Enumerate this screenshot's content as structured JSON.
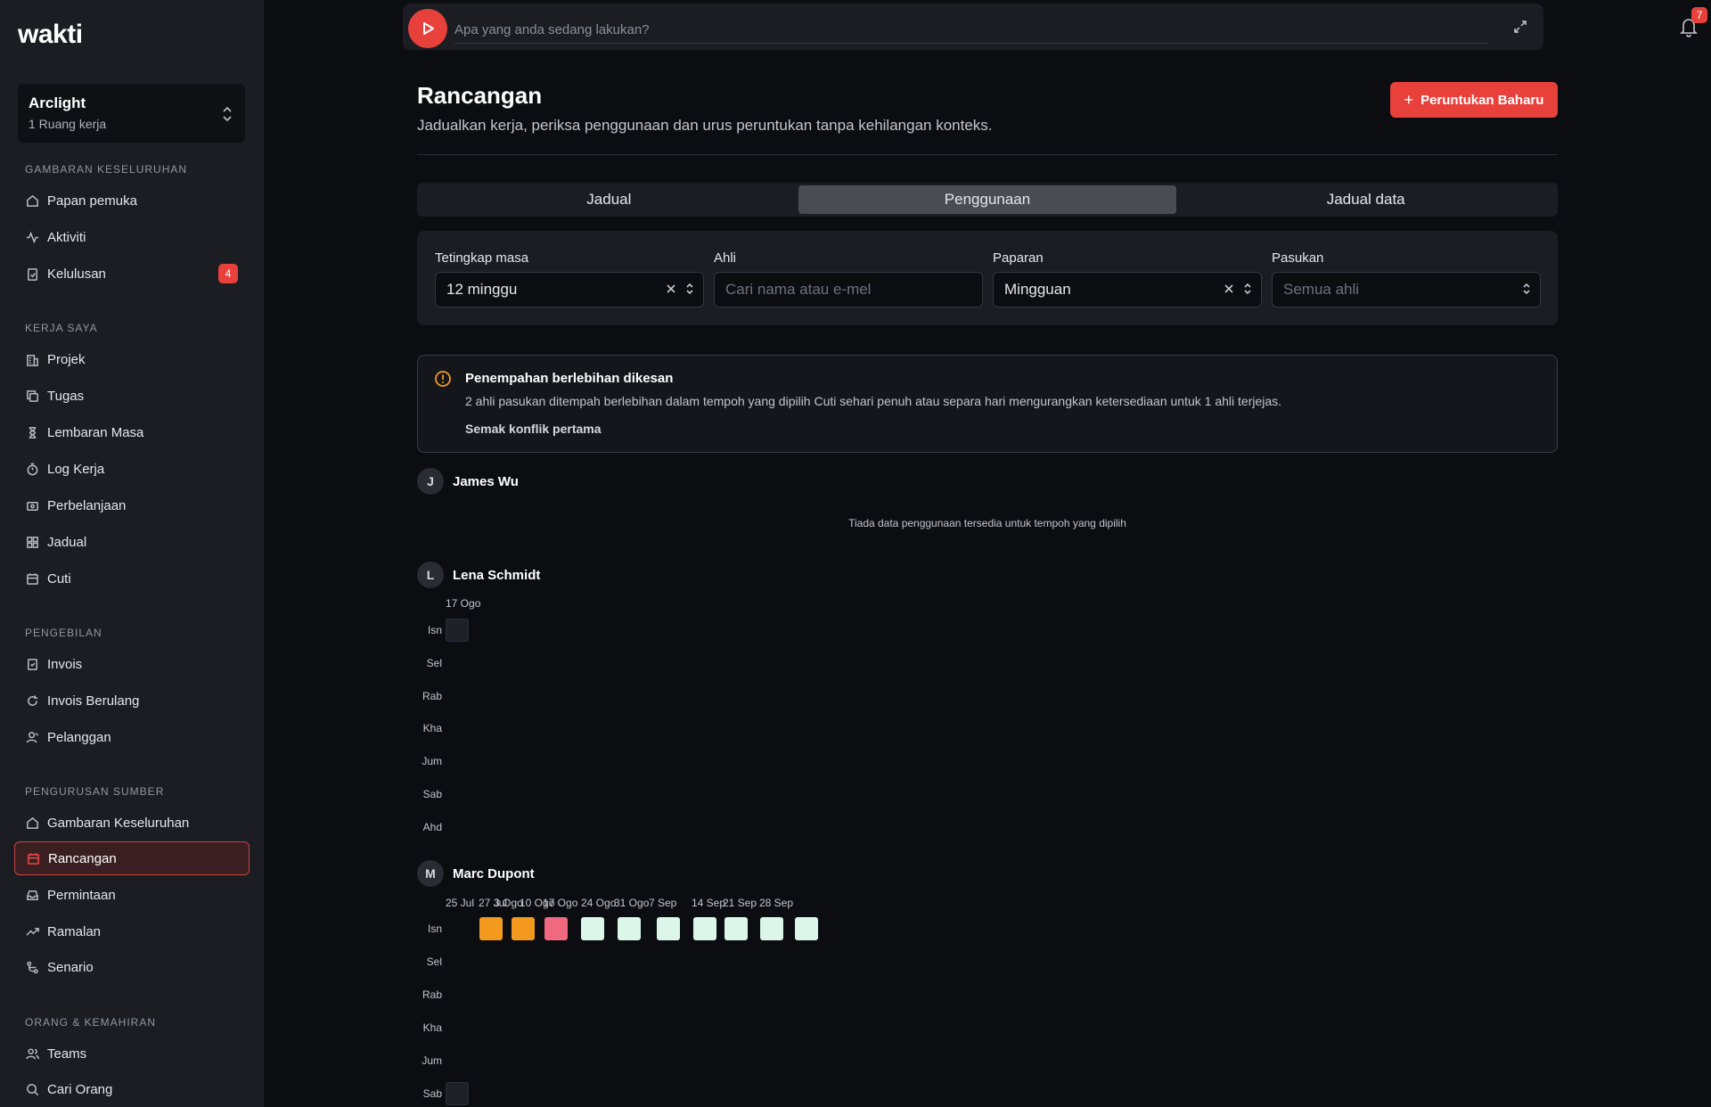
{
  "app": {
    "logo": "wakti"
  },
  "workspace": {
    "name": "Arclight",
    "sub": "1 Ruang kerja"
  },
  "sidebar": {
    "sections": [
      {
        "title": "GAMBARAN KESELURUHAN",
        "items": [
          {
            "label": "Papan pemuka",
            "icon": "home-icon"
          },
          {
            "label": "Aktiviti",
            "icon": "activity-icon"
          },
          {
            "label": "Kelulusan",
            "icon": "clipboard-check-icon",
            "badge": "4"
          }
        ]
      },
      {
        "title": "KERJA SAYA",
        "items": [
          {
            "label": "Projek",
            "icon": "building-icon"
          },
          {
            "label": "Tugas",
            "icon": "copy-icon"
          },
          {
            "label": "Lembaran Masa",
            "icon": "hourglass-icon"
          },
          {
            "label": "Log Kerja",
            "icon": "timer-icon"
          },
          {
            "label": "Perbelanjaan",
            "icon": "receipt-icon"
          },
          {
            "label": "Jadual",
            "icon": "grid-icon"
          },
          {
            "label": "Cuti",
            "icon": "calendar-icon"
          }
        ]
      },
      {
        "title": "PENGEBILAN",
        "items": [
          {
            "label": "Invois",
            "icon": "invoice-icon"
          },
          {
            "label": "Invois Berulang",
            "icon": "refresh-icon"
          },
          {
            "label": "Pelanggan",
            "icon": "user-icon"
          }
        ]
      },
      {
        "title": "PENGURUSAN SUMBER",
        "items": [
          {
            "label": "Gambaran Keseluruhan",
            "icon": "home-icon"
          },
          {
            "label": "Rancangan",
            "icon": "calendar-icon",
            "active": true
          },
          {
            "label": "Permintaan",
            "icon": "inbox-icon"
          },
          {
            "label": "Ramalan",
            "icon": "trend-icon"
          },
          {
            "label": "Senario",
            "icon": "branch-icon"
          }
        ]
      },
      {
        "title": "ORANG & KEMAHIRAN",
        "items": [
          {
            "label": "Teams",
            "icon": "users-icon"
          },
          {
            "label": "Cari Orang",
            "icon": "search-icon"
          }
        ]
      }
    ]
  },
  "topbar": {
    "placeholder": "Apa yang anda sedang lakukan?",
    "notifications": "7"
  },
  "header": {
    "title": "Rancangan",
    "subtitle": "Jadualkan kerja, periksa penggunaan dan urus peruntukan tanpa kehilangan konteks.",
    "new_button": "Peruntukan Baharu"
  },
  "tabs": [
    {
      "label": "Jadual"
    },
    {
      "label": "Penggunaan",
      "active": true
    },
    {
      "label": "Jadual data"
    }
  ],
  "filters": {
    "time_range": {
      "label": "Tetingkap masa",
      "value": "12 minggu"
    },
    "member": {
      "label": "Ahli",
      "placeholder": "Cari nama atau e-mel"
    },
    "view": {
      "label": "Paparan",
      "value": "Mingguan"
    },
    "team": {
      "label": "Pasukan",
      "placeholder": "Semua ahli"
    }
  },
  "alert": {
    "title": "Penempahan berlebihan dikesan",
    "text": "2 ahli pasukan ditempah berlebihan dalam tempoh yang dipilih Cuti sehari penuh atau separa hari mengurangkan ketersediaan untuk 1 ahli terjejas.",
    "link": "Semak konflik pertama"
  },
  "colors": {
    "accent": "#e8413c",
    "over": "#f39a1e",
    "critical": "#f0697e",
    "light": "#dcf6ea"
  },
  "days": [
    "Isn",
    "Sel",
    "Rab",
    "Kha",
    "Jum",
    "Sab",
    "Ahd"
  ],
  "people": [
    {
      "initial": "J",
      "name": "James Wu",
      "empty_message": "Tiada data penggunaan tersedia untuk tempoh yang dipilih"
    },
    {
      "initial": "L",
      "name": "Lena Schmidt",
      "weeks": [
        "17 Ogo"
      ]
    },
    {
      "initial": "M",
      "name": "Marc Dupont",
      "weeks": [
        "25 Jul",
        "27 Jul",
        "3 Ogo",
        "10 Ogo",
        "17 Ogo",
        "24 Ogo",
        "31 Ogo",
        "7 Sep",
        "14 Sep",
        "21 Sep",
        "28 Sep"
      ]
    }
  ]
}
